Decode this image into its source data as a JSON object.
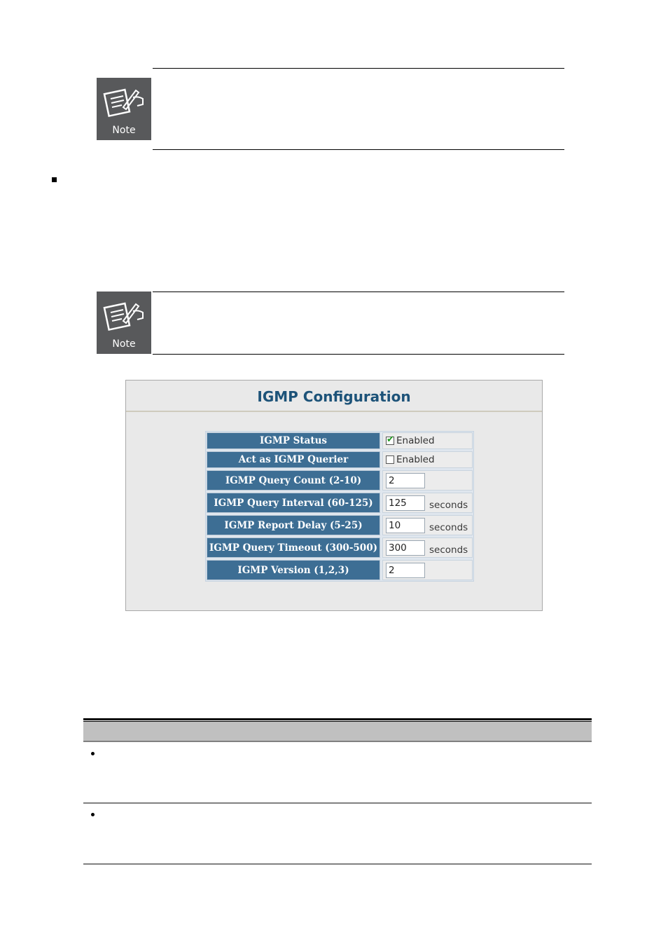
{
  "notes": [
    {
      "icon": "note-icon",
      "label": "Note"
    },
    {
      "icon": "note-icon",
      "label": "Note"
    }
  ],
  "section_bullet": "square-bullet",
  "igmp_config": {
    "title": "IGMP Configuration",
    "rows": [
      {
        "label": "IGMP Status",
        "type": "checkbox",
        "checked": true,
        "text": "Enabled"
      },
      {
        "label": "Act as IGMP Querier",
        "type": "checkbox",
        "checked": false,
        "text": "Enabled"
      },
      {
        "label": "IGMP Query Count (2-10)",
        "type": "input",
        "value": "2",
        "unit": ""
      },
      {
        "label": "IGMP Query Interval (60-125)",
        "type": "input",
        "value": "125",
        "unit": "seconds"
      },
      {
        "label": "IGMP Report Delay (5-25)",
        "type": "input",
        "value": "10",
        "unit": "seconds"
      },
      {
        "label": "IGMP Query Timeout (300-500)",
        "type": "input",
        "value": "300",
        "unit": "seconds"
      },
      {
        "label": "IGMP Version (1,2,3)",
        "type": "input",
        "value": "2",
        "unit": ""
      }
    ],
    "colors": {
      "label_bg": "#3d6e94",
      "title": "#1d5379",
      "check": "#1c9a1c"
    }
  },
  "param_table": {
    "rows": [
      {
        "bullet": "round-bullet"
      },
      {
        "bullet": "round-bullet"
      }
    ]
  }
}
